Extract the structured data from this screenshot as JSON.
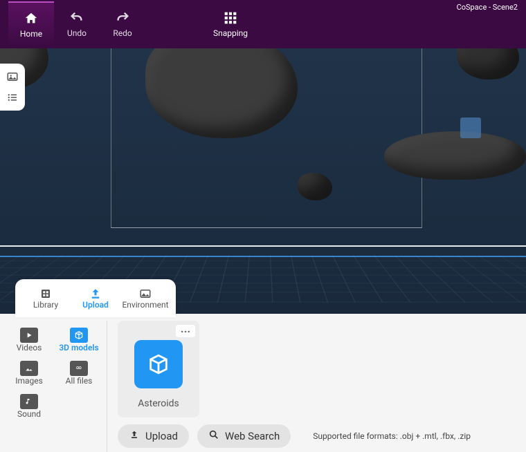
{
  "app_title": "CoSpace - Scene2",
  "toolbar": {
    "home": "Home",
    "undo": "Undo",
    "redo": "Redo",
    "snapping": "Snapping"
  },
  "panel_tabs": {
    "library": "Library",
    "upload": "Upload",
    "environment": "Environment"
  },
  "filters": {
    "videos": "Videos",
    "models3d": "3D models",
    "images": "Images",
    "allfiles": "All files",
    "sound": "Sound"
  },
  "asset": {
    "name": "Asteroids"
  },
  "actions": {
    "upload": "Upload",
    "websearch": "Web Search"
  },
  "formats_label": "Supported file formats: .obj + .mtl, .fbx, .zip"
}
